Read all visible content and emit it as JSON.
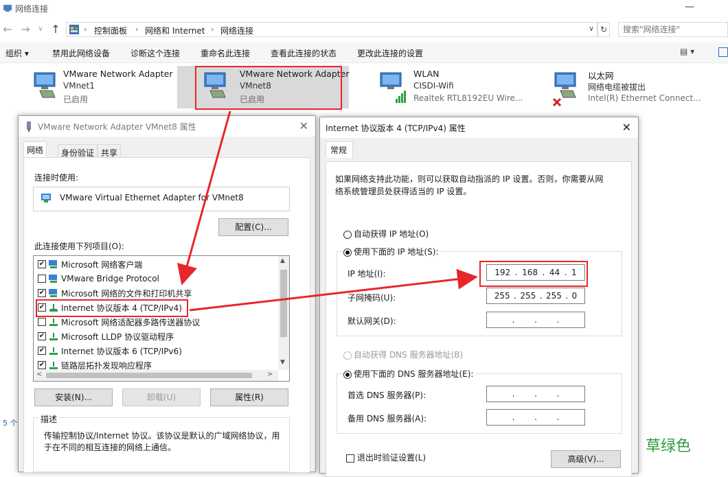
{
  "window": {
    "title": "网络连接",
    "minimize_glyph": "—"
  },
  "addressbar": {
    "crumbs": [
      "控制面板",
      "网络和 Internet",
      "网络连接"
    ],
    "search_placeholder": "搜索\"网络连接\""
  },
  "toolbar": {
    "items": [
      "组织 ▾",
      "禁用此网络设备",
      "诊断这个连接",
      "重命名此连接",
      "查看此连接的状态",
      "更改此连接的设置"
    ]
  },
  "adapters": [
    {
      "name": "VMware Network Adapter",
      "line2": "VMnet1",
      "line3": "已启用"
    },
    {
      "name": "VMware Network Adapter",
      "line2": "VMnet8",
      "line3": "已启用"
    },
    {
      "name": "WLAN",
      "line2": "CISDI-Wifi",
      "line3": "Realtek RTL8192EU Wire..."
    },
    {
      "name": "以太网",
      "line2": "网络电缆被拔出",
      "line3": "Intel(R) Ethernet Connect..."
    }
  ],
  "statusbar": {
    "count": "5 个"
  },
  "left_dialog": {
    "title": "VMware Network Adapter VMnet8 属性",
    "tabs": [
      "网络",
      "身份验证",
      "共享"
    ],
    "connect_using_label": "连接时使用:",
    "adapter_name": "VMware Virtual Ethernet Adapter for VMnet8",
    "configure_button": "配置(C)...",
    "items_label": "此连接使用下列项目(O):",
    "items": [
      {
        "label": "Microsoft 网络客户端",
        "checked": true
      },
      {
        "label": "VMware Bridge Protocol",
        "checked": false
      },
      {
        "label": "Microsoft 网络的文件和打印机共享",
        "checked": true
      },
      {
        "label": "Internet 协议版本 4 (TCP/IPv4)",
        "checked": true
      },
      {
        "label": "Microsoft 网络适配器多路传送器协议",
        "checked": false
      },
      {
        "label": "Microsoft LLDP 协议驱动程序",
        "checked": true
      },
      {
        "label": "Internet 协议版本 6 (TCP/IPv6)",
        "checked": true
      },
      {
        "label": "链路层拓扑发现响应程序",
        "checked": true
      }
    ],
    "install_button": "安装(N)...",
    "uninstall_button": "卸载(U)",
    "properties_button": "属性(R)",
    "description_label": "描述",
    "description_text_1": "传输控制协议/Internet 协议。该协议是默认的广域网络协议，用",
    "description_text_2": "于在不同的相互连接的网络上通信。"
  },
  "right_dialog": {
    "title": "Internet 协议版本 4 (TCP/IPv4) 属性",
    "tab": "常规",
    "intro_1": "如果网络支持此功能，则可以获取自动指派的 IP 设置。否则，你需要从网",
    "intro_2": "络系统管理员处获得适当的 IP 设置。",
    "auto_ip_label": "自动获得 IP 地址(O)",
    "manual_ip_label": "使用下面的 IP 地址(S):",
    "ip_label": "IP 地址(I):",
    "ip_value": [
      "192",
      "168",
      "44",
      "1"
    ],
    "mask_label": "子网掩码(U):",
    "mask_value": [
      "255",
      "255",
      "255",
      "0"
    ],
    "gateway_label": "默认网关(D):",
    "auto_dns_label": "自动获得 DNS 服务器地址(B)",
    "manual_dns_label": "使用下面的 DNS 服务器地址(E):",
    "preferred_dns_label": "首选 DNS 服务器(P):",
    "alternate_dns_label": "备用 DNS 服务器(A):",
    "validate_label": "退出时验证设置(L)",
    "advanced_button": "高级(V)..."
  },
  "watermark": "草绿色",
  "colors": {
    "highlight": "#e8262b",
    "watermark": "#2e9a3e",
    "selected_bg": "#d9d9d9"
  }
}
